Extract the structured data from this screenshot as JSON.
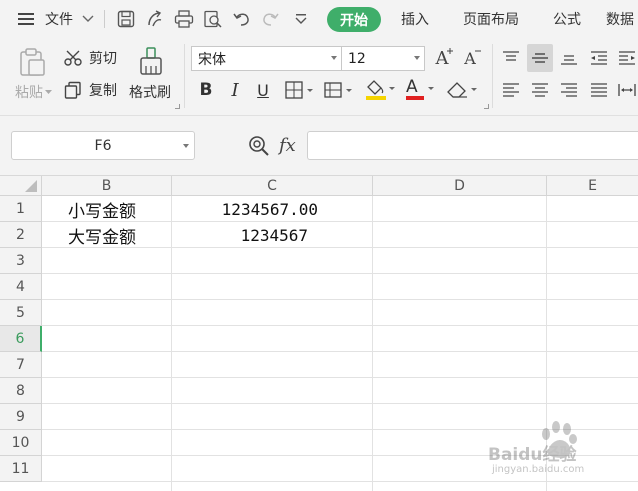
{
  "menubar": {
    "file_label": "文件",
    "tabs": [
      "开始",
      "插入",
      "页面布局",
      "公式",
      "数据"
    ],
    "active_tab": "开始"
  },
  "ribbon": {
    "paste_label": "粘贴",
    "cut_label": "剪切",
    "copy_label": "复制",
    "format_painter_label": "格式刷",
    "font_name": "宋体",
    "font_size": "12",
    "bold": "B",
    "italic": "I",
    "underline": "U",
    "font_color_letter": "A",
    "grow_font": "A",
    "shrink_font": "A"
  },
  "formula_bar": {
    "name_box": "F6",
    "fx_label": "fx",
    "formula_value": ""
  },
  "sheet": {
    "columns": [
      "B",
      "C",
      "D",
      "E"
    ],
    "rows": [
      "1",
      "2",
      "3",
      "4",
      "5",
      "6",
      "7",
      "8",
      "9",
      "10",
      "11"
    ],
    "active_row": "6",
    "cells": {
      "B1": "小写金额",
      "C1": "1234567.00",
      "B2": "大写金额",
      "C2": "1234567"
    }
  },
  "colors": {
    "accent": "#3fae6a",
    "ribbon_bg": "#f3f3f3",
    "font_color_bar": "#e02020",
    "fill_color_bar": "#f5d400"
  },
  "watermark": {
    "brand": "Baidu经验",
    "url": "jingyan.baidu.com"
  }
}
